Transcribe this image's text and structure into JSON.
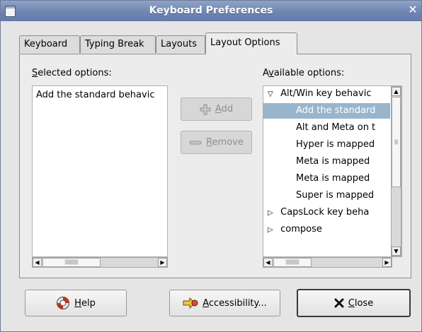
{
  "window": {
    "title": "Keyboard Preferences"
  },
  "tabs": [
    {
      "label": "Keyboard"
    },
    {
      "label": "Typing Break"
    },
    {
      "label": "Layouts"
    },
    {
      "label": "Layout Options"
    }
  ],
  "selected_options": {
    "label_mnemonic": "S",
    "label_rest": "elected options:",
    "items": [
      "Add the standard behavic"
    ]
  },
  "available_options": {
    "label_first": "A",
    "label_mnemonic": "v",
    "label_rest": "ailable options:",
    "group_open_marker": "▽",
    "group_closed_marker": "▷",
    "items": [
      "Alt/Win key behavic",
      "Add the standard",
      "Alt and Meta on t",
      "Hyper is mapped",
      "Meta is mapped",
      "Meta is mapped",
      "Super is mapped",
      "CapsLock key beha",
      "compose"
    ]
  },
  "buttons": {
    "add_mnemonic": "A",
    "add_rest": "dd",
    "remove_mnemonic": "R",
    "remove_rest": "emove",
    "help_mnemonic": "H",
    "help_rest": "elp",
    "accessibility_mnemonic": "A",
    "accessibility_rest": "ccessibility...",
    "close_mnemonic": "C",
    "close_rest": "lose"
  },
  "scrollbars": {
    "thumb_grip": "▒▒▒▒",
    "arrow_left": "◀",
    "arrow_right": "▶",
    "arrow_up": "▲",
    "arrow_down": "▼"
  },
  "icons": {
    "window": "window-menu-icon",
    "close": "window-close-icon",
    "add": "add-plus-icon",
    "remove": "remove-minus-icon",
    "help": "lifebuoy-help-icon",
    "accessibility": "accessibility-icon",
    "close_button": "close-x-icon"
  },
  "colors": {
    "titlebar": "#6f86b3",
    "selection": "#98b5cc"
  }
}
